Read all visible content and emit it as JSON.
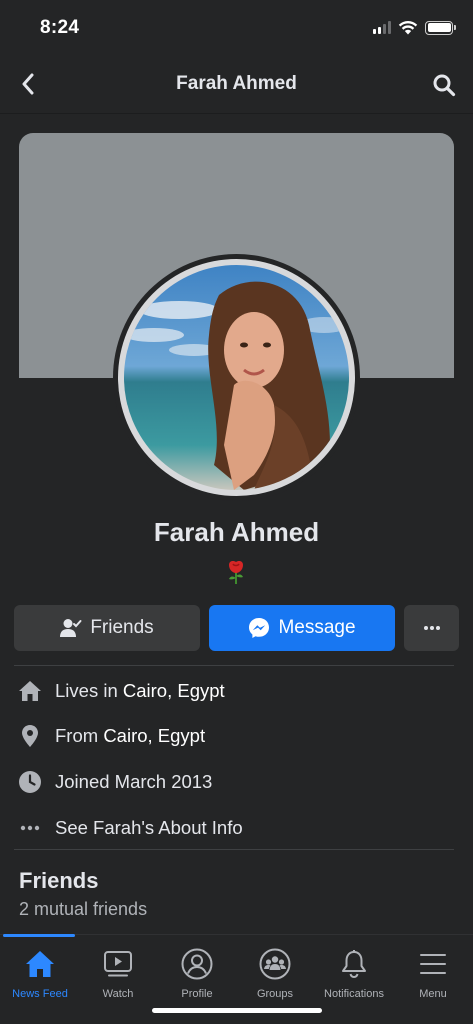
{
  "status_bar": {
    "time": "8:24"
  },
  "header": {
    "title": "Farah Ahmed"
  },
  "profile": {
    "name": "Farah Ahmed",
    "emoji": "🌹"
  },
  "actions": {
    "friends_label": "Friends",
    "message_label": "Message",
    "more_label": "···"
  },
  "info": [
    {
      "prefix": "Lives in ",
      "bold": "Cairo, Egypt",
      "icon": "home-icon"
    },
    {
      "prefix": "From ",
      "bold": "Cairo, Egypt",
      "icon": "location-pin-icon"
    },
    {
      "prefix": "Joined March 2013",
      "bold": "",
      "icon": "clock-icon"
    },
    {
      "prefix": "See Farah's About Info",
      "bold": "",
      "icon": "more-dots-icon"
    }
  ],
  "friends_section": {
    "title": "Friends",
    "subtitle": "2 mutual friends"
  },
  "tabs": [
    {
      "label": "News Feed",
      "icon": "home-icon",
      "active": true
    },
    {
      "label": "Watch",
      "icon": "watch-icon",
      "active": false
    },
    {
      "label": "Profile",
      "icon": "profile-icon",
      "active": false
    },
    {
      "label": "Groups",
      "icon": "groups-icon",
      "active": false
    },
    {
      "label": "Notifications",
      "icon": "bell-icon",
      "active": false
    },
    {
      "label": "Menu",
      "icon": "menu-icon",
      "active": false
    }
  ],
  "colors": {
    "background": "#242526",
    "accent": "#1877f2",
    "active_tab": "#2d88ff",
    "cover": "#8c9194"
  }
}
